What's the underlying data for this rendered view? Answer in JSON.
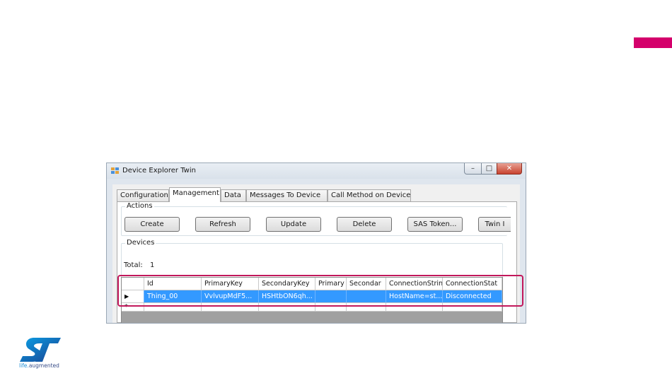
{
  "window": {
    "title": "Device Explorer Twin",
    "controls": {
      "minimize": "–",
      "maximize": "□",
      "close": "✕"
    }
  },
  "tabs": [
    {
      "label": "Configuration",
      "active": false
    },
    {
      "label": "Management",
      "active": true
    },
    {
      "label": "Data",
      "active": false
    },
    {
      "label": "Messages To Device",
      "active": false
    },
    {
      "label": "Call Method on Device",
      "active": false
    }
  ],
  "actions": {
    "label": "Actions",
    "buttons": [
      "Create",
      "Refresh",
      "Update",
      "Delete",
      "SAS Token...",
      "Twin I"
    ]
  },
  "devices": {
    "label": "Devices",
    "total_label": "Total:",
    "total_value": "1",
    "columns": [
      "Id",
      "PrimaryKey",
      "SecondaryKey",
      "Primary",
      "Secondar",
      "ConnectionStrin",
      "ConnectionStat"
    ],
    "rows": [
      [
        "Thing_00",
        "VvlvupMdF5...",
        "HSHtbON6qh...",
        "",
        "",
        "HostName=st...",
        "Disconnected"
      ]
    ],
    "selected_marker": "▶",
    "new_row_marker": "*"
  },
  "branding": {
    "tagline_prefix": "life.",
    "tagline_suffix": "augmented",
    "accent_color": "#d4006b",
    "highlight_color": "#c2185b",
    "selection_color": "#3399ff"
  }
}
